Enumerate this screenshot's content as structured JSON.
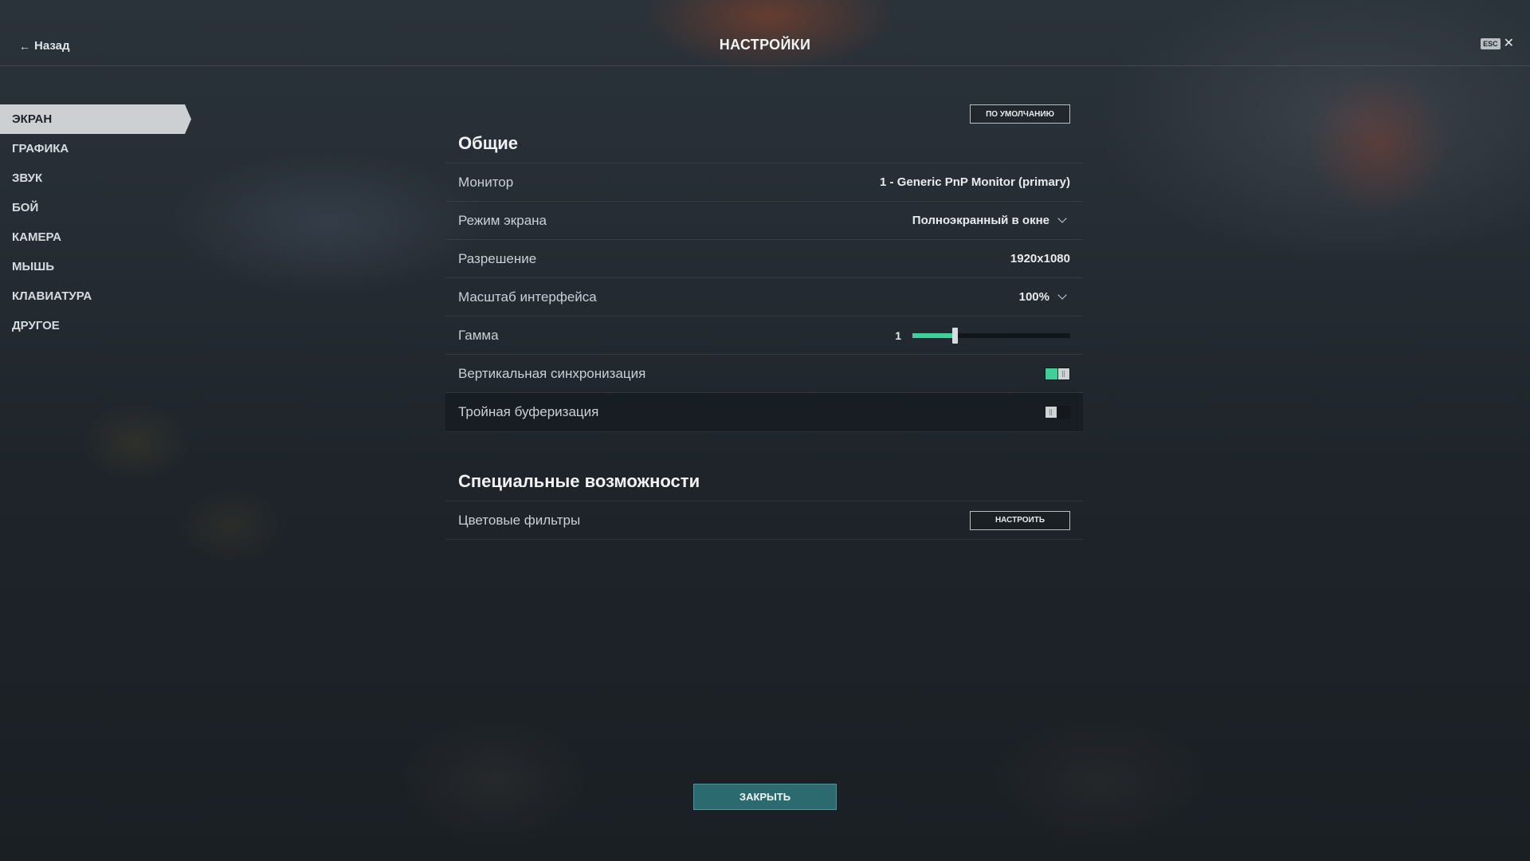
{
  "header": {
    "back_label": "Назад",
    "title": "НАСТРОЙКИ",
    "esc_key": "ESC",
    "close_glyph": "✕"
  },
  "sidebar": {
    "items": [
      {
        "label": "ЭКРАН",
        "active": true
      },
      {
        "label": "ГРАФИКА"
      },
      {
        "label": "ЗВУК"
      },
      {
        "label": "БОЙ"
      },
      {
        "label": "КАМЕРА"
      },
      {
        "label": "МЫШЬ"
      },
      {
        "label": "КЛАВИАТУРА"
      },
      {
        "label": "ДРУГОЕ"
      }
    ]
  },
  "main": {
    "default_button": "ПО УМОЛЧАНИЮ",
    "general": {
      "title": "Общие",
      "monitor": {
        "label": "Монитор",
        "value": "1 - Generic PnP Monitor (primary)"
      },
      "screen_mode": {
        "label": "Режим экрана",
        "value": "Полноэкранный в окне"
      },
      "resolution": {
        "label": "Разрешение",
        "value": "1920x1080"
      },
      "ui_scale": {
        "label": "Масштаб интерфейса",
        "value": "100%"
      },
      "gamma": {
        "label": "Гамма",
        "value": "1",
        "level": 0.27
      },
      "vsync": {
        "label": "Вертикальная синхронизация",
        "enabled": true
      },
      "triple_buffer": {
        "label": "Тройная буферизация",
        "enabled": false
      }
    },
    "accessibility": {
      "title": "Специальные возможности",
      "color_filters": {
        "label": "Цветовые фильтры",
        "button": "НАСТРОИТЬ"
      }
    }
  },
  "footer": {
    "close_button": "ЗАКРЫТЬ"
  },
  "colors": {
    "accent": "#3fcf9a",
    "close_button": "#2b6b70"
  },
  "icons": {
    "back": "arrow-left-icon",
    "close": "close-icon",
    "dropdown": "chevron-down-icon"
  }
}
